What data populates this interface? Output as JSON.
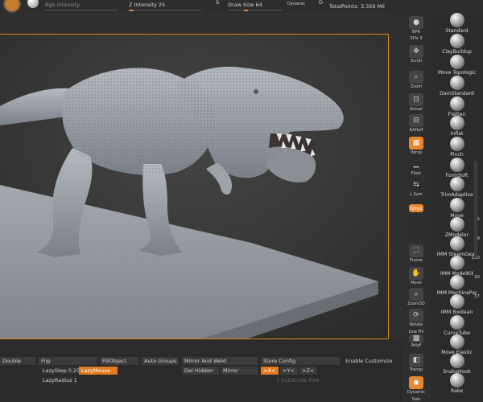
{
  "topbar": {
    "rgb_intensity": "Rgb Intensity",
    "z_intensity": "Z Intensity 25",
    "s_label": "S",
    "draw_size": "Draw Size 64",
    "dynamic": "Dynamic",
    "d_label": "D",
    "total_points": "TotalPoints: 3.359 Mil"
  },
  "tools": {
    "bpr": "BPR",
    "spix": "SPix 3",
    "scroll": "Scroll",
    "zoom": "Zoom",
    "actual": "Actual",
    "aahalf": "AAHalf",
    "persp": "Persp",
    "floor": "Floor",
    "quick": "L.Sym",
    "xyz": "Qxyz",
    "frame": "Frame",
    "move": "Move",
    "zoom3d": "Zoom3D",
    "rotate": "Rotate",
    "linefill": "Line Fill",
    "polyf": "PolyF",
    "transp": "Transp",
    "dynamic": "Dynamic",
    "solo": "Solo"
  },
  "brushes": [
    {
      "label": "Standard",
      "count": ""
    },
    {
      "label": "ClayBuildup",
      "count": ""
    },
    {
      "label": "Move Topologic",
      "count": ""
    },
    {
      "label": "DamStandard",
      "count": ""
    },
    {
      "label": "Flatten",
      "count": ""
    },
    {
      "label": "Inflat",
      "count": ""
    },
    {
      "label": "Pinch",
      "count": ""
    },
    {
      "label": "FormSoft",
      "count": ""
    },
    {
      "label": "TrimAdaptive",
      "count": ""
    },
    {
      "label": "Move",
      "count": ""
    },
    {
      "label": "ZModeler",
      "count": "1"
    },
    {
      "label": "IMM SteamGear",
      "count": "29"
    },
    {
      "label": "IMM ModelKit",
      "count": "120"
    },
    {
      "label": "IMM MachinePar",
      "count": "30"
    },
    {
      "label": "IMM Boolean",
      "count": "37"
    },
    {
      "label": "CurveTube",
      "count": ""
    },
    {
      "label": "Move Elastic",
      "count": ""
    },
    {
      "label": "SnakeHook",
      "count": ""
    },
    {
      "label": "Rake",
      "count": ""
    }
  ],
  "bottom": {
    "double": "Double",
    "flip": "Flip",
    "fill_object": "FillObject",
    "auto_groups": "Auto Groups",
    "mirror_and_weld": "Mirror And Weld",
    "store_config": "Store Config",
    "enable_customize": "Enable Customize",
    "lazy_step": "LazyStep 0.25",
    "lazy_mouse": "LazyMouse",
    "del_hidden": "Del Hidden",
    "mirror": "Mirror",
    "x_axis": ">X<",
    "y_axis": ">Y<",
    "z_axis": ">Z<",
    "lazy_radius": "LazyRadius 1",
    "subdiv_hint": "3 Subdivide Fine"
  },
  "colors": {
    "accent": "#e8862e",
    "frame": "#d9881f",
    "panel": "#2e2e2e"
  }
}
